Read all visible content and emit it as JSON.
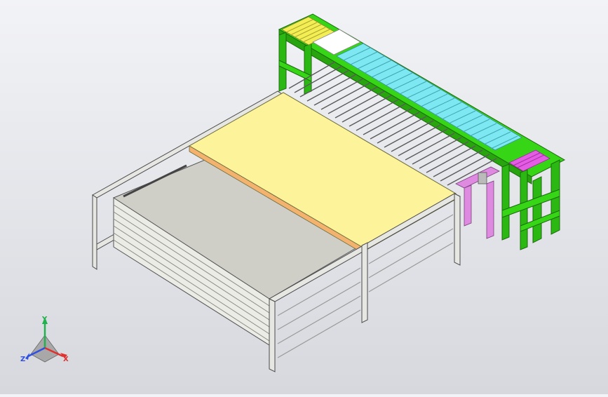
{
  "view": {
    "name": "cad-isometric-view",
    "background_top": "#f2f3f6",
    "background_bottom": "#d6d8de"
  },
  "colors": {
    "frame_green": "#36d616",
    "frame_green_dark": "#1e8f0c",
    "frame_gray": "#e6e6e3",
    "frame_outline": "#4a4a4a",
    "panel_yellow": "#fdf39a",
    "panel_gray": "#cfcfc8",
    "roller_yellow": "#f4ee55",
    "roller_white": "#ffffff",
    "roller_cyan": "#7ee8f2",
    "roller_gray": "#d9d9d9",
    "roller_magenta": "#e45be4",
    "support_pink": "#de8ae0",
    "edge_orange": "#f3b36e"
  },
  "triad": {
    "x_label": "X",
    "y_label": "Y",
    "z_label": "Z",
    "x_color": "#e03030",
    "y_color": "#22b14c",
    "z_color": "#3050e0"
  }
}
